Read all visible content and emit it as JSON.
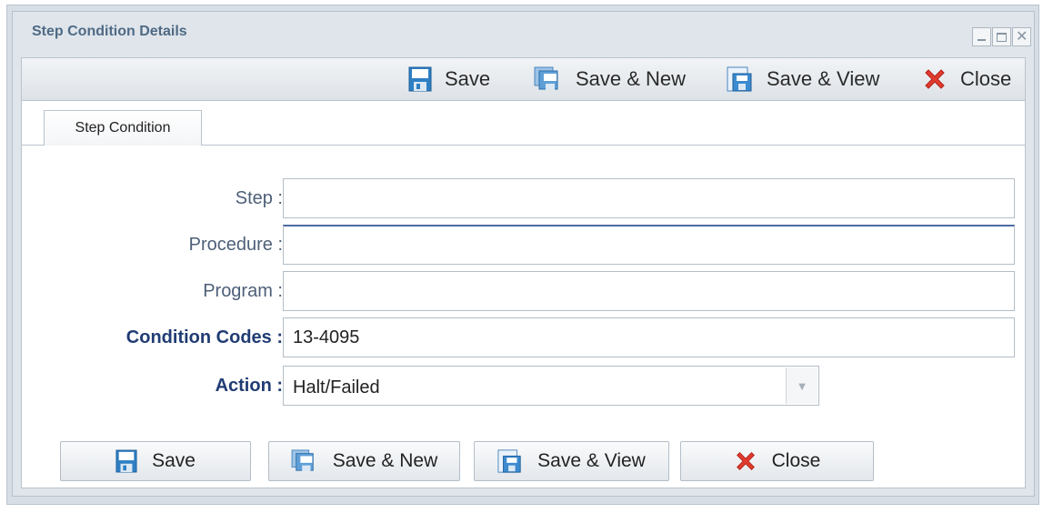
{
  "window": {
    "title": "Step Condition Details",
    "controls": {
      "minimize": "minimize",
      "maximize": "maximize",
      "close": "close"
    }
  },
  "toolbar": {
    "save_label": "Save",
    "save_new_label": "Save & New",
    "save_view_label": "Save & View",
    "close_label": "Close"
  },
  "tabs": [
    {
      "label": "Step Condition",
      "active": true
    }
  ],
  "form": {
    "step": {
      "label": "Step :",
      "value": ""
    },
    "procedure": {
      "label": "Procedure :",
      "value": ""
    },
    "program": {
      "label": "Program :",
      "value": ""
    },
    "condition_codes": {
      "label": "Condition Codes :",
      "value": "13-4095"
    },
    "action": {
      "label": "Action :",
      "value": "Halt/Failed"
    }
  },
  "buttons": {
    "save_label": "Save",
    "save_new_label": "Save & New",
    "save_view_label": "Save & View",
    "close_label": "Close"
  },
  "icons": {
    "save": "floppy-disk-icon",
    "save_new": "save-new-icon",
    "save_view": "save-view-icon",
    "close": "red-x-close-icon"
  },
  "colors": {
    "title": "#4f6a84",
    "required_label": "#203c74",
    "label": "#4d5f78",
    "close_icon": "#e23b2e",
    "save_icon": "#2f7fc4"
  }
}
